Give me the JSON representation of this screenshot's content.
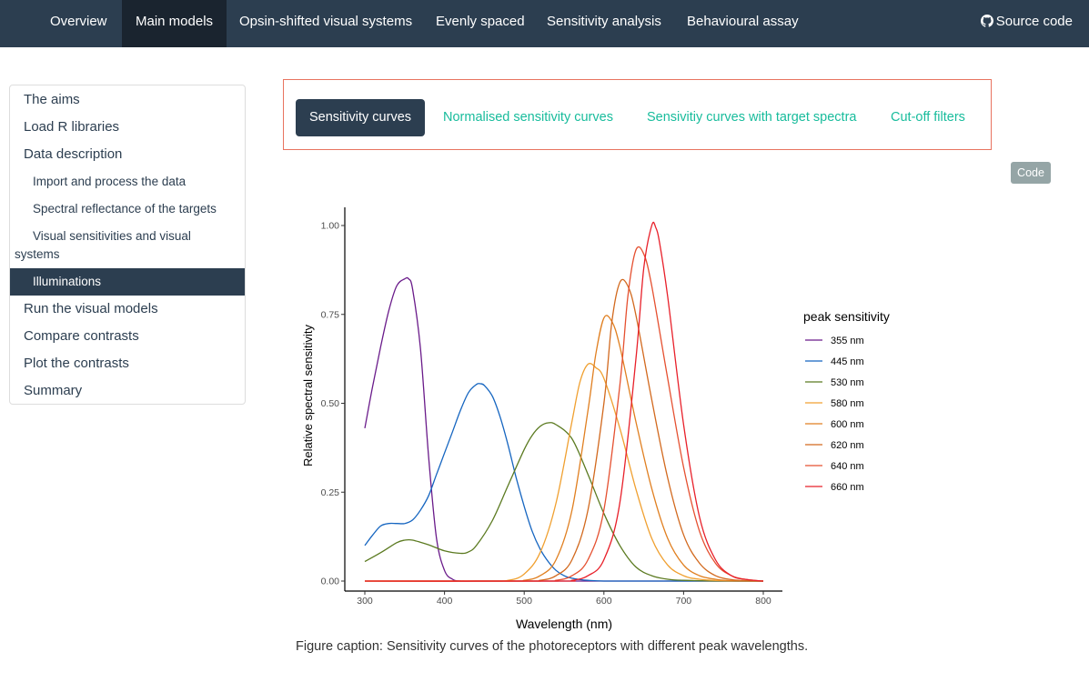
{
  "navbar": {
    "items": [
      {
        "label": "Overview",
        "active": false
      },
      {
        "label": "Main models",
        "active": true
      },
      {
        "label": "Opsin-shifted visual systems",
        "active": false
      },
      {
        "label": "Evenly spaced",
        "active": false
      },
      {
        "label": "Sensitivity analysis",
        "active": false
      },
      {
        "label": "Behavioural assay",
        "active": false
      }
    ],
    "source_label": "Source code",
    "source_icon": "github-icon"
  },
  "toc": {
    "items": [
      {
        "label": "The aims",
        "level": 1
      },
      {
        "label": "Load R libraries",
        "level": 1
      },
      {
        "label": "Data description",
        "level": 1
      },
      {
        "label": "Import and process the data",
        "level": 2
      },
      {
        "label": "Spectral reflectance of the targets",
        "level": 2
      },
      {
        "label": "Visual sensitivities and visual systems",
        "level": 2
      },
      {
        "label": "Illuminations",
        "level": 2,
        "active": true
      },
      {
        "label": "Run the visual models",
        "level": 1
      },
      {
        "label": "Compare contrasts",
        "level": 1
      },
      {
        "label": "Plot the contrasts",
        "level": 1
      },
      {
        "label": "Summary",
        "level": 1
      }
    ]
  },
  "tabs": [
    {
      "label": "Sensitivity curves",
      "active": true
    },
    {
      "label": "Normalised sensitivity curves",
      "active": false
    },
    {
      "label": "Sensivitiy curves with target spectra",
      "active": false
    },
    {
      "label": "Cut-off filters",
      "active": false
    }
  ],
  "code_button": "Code",
  "caption": "Figure caption: Sensitivity curves of the photoreceptors with different peak wavelengths.",
  "colors": {
    "navbar": "#2c3e50",
    "accent": "#18bc9c",
    "tab_border": "#e8735f",
    "code_button": "#95a5a6"
  },
  "chart_data": {
    "type": "line",
    "xlabel": "Wavelength (nm)",
    "ylabel": "Relative spectral sensitivity",
    "xlim": [
      300,
      800
    ],
    "ylim": [
      0,
      1
    ],
    "xticks": [
      300,
      400,
      500,
      600,
      700,
      800
    ],
    "yticks": [
      0,
      0.25,
      0.5,
      0.75,
      1
    ],
    "ytick_labels": [
      "0.00",
      "0.25",
      "0.50",
      "0.75",
      "1.00"
    ],
    "legend_title": "peak sensitivity",
    "legend_position": "right",
    "series": [
      {
        "name": "355 nm",
        "color": "#6a1b8a",
        "x": [
          300,
          310,
          320,
          330,
          340,
          350,
          355,
          360,
          370,
          380,
          390,
          400,
          410,
          420,
          440,
          500,
          800
        ],
        "y": [
          0.43,
          0.55,
          0.66,
          0.76,
          0.83,
          0.85,
          0.85,
          0.82,
          0.65,
          0.35,
          0.12,
          0.03,
          0.005,
          0,
          0,
          0,
          0
        ]
      },
      {
        "name": "445 nm",
        "color": "#1565c0",
        "x": [
          300,
          310,
          320,
          330,
          340,
          350,
          360,
          370,
          380,
          390,
          400,
          410,
          420,
          430,
          440,
          445,
          450,
          460,
          470,
          480,
          490,
          500,
          510,
          520,
          530,
          540,
          550,
          560,
          570,
          580,
          600,
          650,
          800
        ],
        "y": [
          0.1,
          0.13,
          0.155,
          0.162,
          0.162,
          0.162,
          0.172,
          0.2,
          0.24,
          0.3,
          0.36,
          0.42,
          0.48,
          0.53,
          0.553,
          0.555,
          0.55,
          0.52,
          0.46,
          0.38,
          0.29,
          0.21,
          0.14,
          0.09,
          0.055,
          0.03,
          0.015,
          0.008,
          0.004,
          0.002,
          0,
          0,
          0
        ]
      },
      {
        "name": "530 nm",
        "color": "#5b7a20",
        "x": [
          300,
          320,
          340,
          350,
          360,
          380,
          400,
          420,
          430,
          440,
          460,
          480,
          500,
          510,
          520,
          530,
          540,
          560,
          580,
          600,
          620,
          640,
          660,
          680,
          700,
          750,
          800
        ],
        "y": [
          0.055,
          0.08,
          0.108,
          0.115,
          0.115,
          0.102,
          0.085,
          0.078,
          0.082,
          0.1,
          0.17,
          0.27,
          0.37,
          0.41,
          0.435,
          0.445,
          0.44,
          0.4,
          0.3,
          0.19,
          0.1,
          0.04,
          0.015,
          0.005,
          0.002,
          0,
          0
        ]
      },
      {
        "name": "580 nm",
        "color": "#f0a030",
        "x": [
          300,
          450,
          480,
          500,
          520,
          540,
          560,
          570,
          580,
          590,
          600,
          620,
          640,
          660,
          680,
          700,
          720,
          750,
          800
        ],
        "y": [
          0,
          0,
          0.002,
          0.02,
          0.08,
          0.22,
          0.45,
          0.56,
          0.61,
          0.6,
          0.57,
          0.43,
          0.26,
          0.12,
          0.045,
          0.015,
          0.005,
          0.001,
          0
        ]
      },
      {
        "name": "600 nm",
        "color": "#e07f20",
        "x": [
          300,
          480,
          500,
          520,
          540,
          560,
          580,
          590,
          600,
          610,
          620,
          640,
          660,
          680,
          700,
          720,
          740,
          760,
          800
        ],
        "y": [
          0,
          0,
          0.002,
          0.015,
          0.06,
          0.2,
          0.48,
          0.64,
          0.74,
          0.73,
          0.66,
          0.45,
          0.26,
          0.12,
          0.045,
          0.015,
          0.005,
          0.001,
          0
        ]
      },
      {
        "name": "620 nm",
        "color": "#d2691e",
        "x": [
          300,
          500,
          520,
          540,
          560,
          580,
          600,
          610,
          620,
          630,
          640,
          660,
          680,
          700,
          720,
          740,
          760,
          780,
          800
        ],
        "y": [
          0,
          0,
          0.002,
          0.015,
          0.06,
          0.2,
          0.5,
          0.73,
          0.84,
          0.83,
          0.75,
          0.51,
          0.29,
          0.13,
          0.05,
          0.015,
          0.004,
          0.001,
          0
        ]
      },
      {
        "name": "640 nm",
        "color": "#e55030",
        "x": [
          300,
          520,
          540,
          560,
          580,
          600,
          620,
          630,
          640,
          650,
          660,
          680,
          700,
          720,
          740,
          760,
          780,
          800
        ],
        "y": [
          0,
          0,
          0.002,
          0.015,
          0.06,
          0.2,
          0.55,
          0.8,
          0.93,
          0.92,
          0.83,
          0.57,
          0.32,
          0.14,
          0.05,
          0.015,
          0.004,
          0
        ]
      },
      {
        "name": "660 nm",
        "color": "#e8202a",
        "x": [
          300,
          540,
          560,
          580,
          600,
          620,
          640,
          650,
          660,
          665,
          670,
          680,
          700,
          720,
          740,
          760,
          780,
          800
        ],
        "y": [
          0,
          0,
          0.002,
          0.015,
          0.06,
          0.22,
          0.62,
          0.88,
          1.0,
          0.995,
          0.95,
          0.8,
          0.44,
          0.18,
          0.06,
          0.015,
          0.004,
          0
        ]
      }
    ]
  }
}
